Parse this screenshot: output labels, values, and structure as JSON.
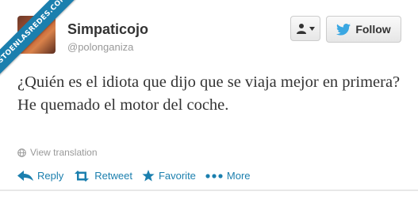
{
  "watermark": "VISTOENLASREDES.COM",
  "user": {
    "name": "Simpaticojo",
    "handle": "@polonganiza"
  },
  "buttons": {
    "follow_label": "Follow"
  },
  "tweet": {
    "text": "¿Quién es el idiota que dijo que se viaja mejor en primera? He quemado el motor del coche.",
    "view_translation": "View translation"
  },
  "actions": {
    "reply": "Reply",
    "retweet": "Retweet",
    "favorite": "Favorite",
    "more": "More"
  },
  "colors": {
    "accent": "#1b7fae",
    "twitter_bird": "#3aa7e2",
    "muted": "#999999"
  }
}
